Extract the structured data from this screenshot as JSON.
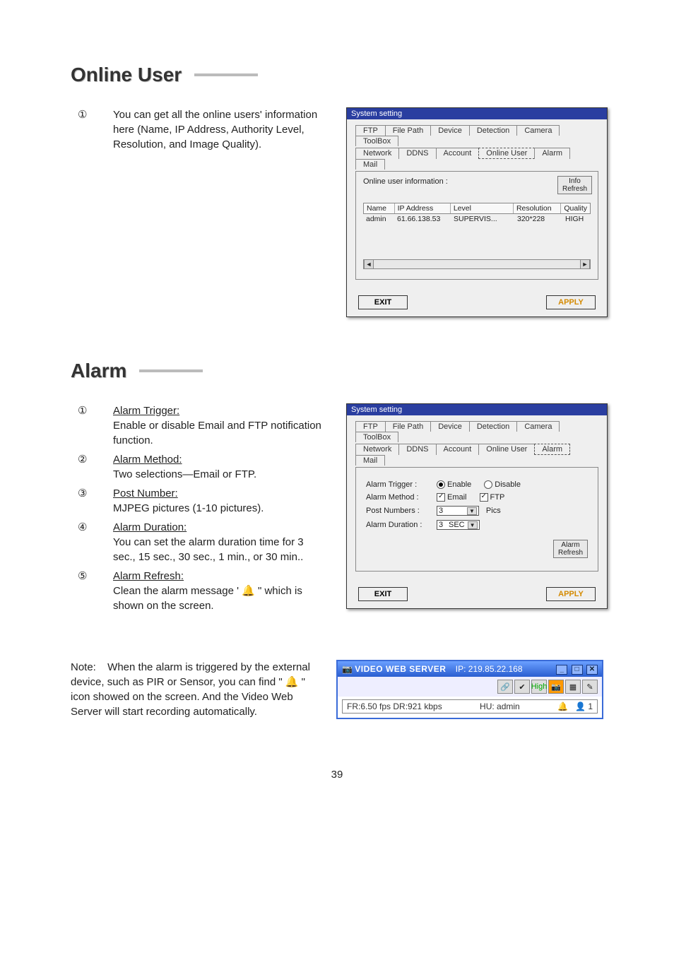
{
  "page_number": "39",
  "section_online_user": {
    "title": "Online User",
    "bullet_glyph": "①",
    "bullet_text": "You can get all the online users' information here (Name, IP Address, Authority Level, Resolution, and Image Quality).",
    "dialog": {
      "title": "System setting",
      "tabs_row1": [
        "FTP",
        "File Path",
        "Device",
        "Detection",
        "Camera",
        "ToolBox"
      ],
      "tabs_row2": [
        "Network",
        "DDNS",
        "Account",
        "Online User",
        "Alarm",
        "Mail"
      ],
      "active_tab": "Online User",
      "panel_label": "Online user information :",
      "info_btn_line1": "Info",
      "info_btn_line2": "Refresh",
      "columns": [
        "Name",
        "IP Address",
        "Level",
        "Resolution",
        "Quality"
      ],
      "row": {
        "name": "admin",
        "ip": "61.66.138.53",
        "level": "SUPERVIS...",
        "res": "320*228",
        "quality": "HIGH"
      },
      "exit": "EXIT",
      "apply": "APPLY"
    }
  },
  "section_alarm": {
    "title": "Alarm",
    "items": [
      {
        "glyph": "①",
        "head": "Alarm Trigger:",
        "body": "Enable or disable Email and FTP notification function."
      },
      {
        "glyph": "②",
        "head": "Alarm Method:",
        "body": "Two selections—Email or FTP."
      },
      {
        "glyph": "③",
        "head": "Post Number:",
        "body": "MJPEG  pictures (1-10 pictures)."
      },
      {
        "glyph": "④",
        "head": "Alarm Duration:",
        "body": "You can set the alarm duration time for 3 sec., 15 sec., 30 sec., 1 min., or 30 min.."
      },
      {
        "glyph": "⑤",
        "head": "Alarm Refresh:",
        "body_pre": "Clean the alarm message ' ",
        "body_post": " \" which is shown on the screen."
      }
    ],
    "dialog": {
      "title": "System setting",
      "tabs_row1": [
        "FTP",
        "File Path",
        "Device",
        "Detection",
        "Camera",
        "ToolBox"
      ],
      "tabs_row2": [
        "Network",
        "DDNS",
        "Account",
        "Online User",
        "Alarm",
        "Mail"
      ],
      "active_tab": "Alarm",
      "labels": {
        "trigger": "Alarm Trigger :",
        "enable": "Enable",
        "disable": "Disable",
        "method": "Alarm Method :",
        "email": "Email",
        "ftp": "FTP",
        "post": "Post Numbers :",
        "post_value": "3",
        "pics": "Pics",
        "duration": "Alarm Duration :",
        "dur_value": "3",
        "sec": "SEC",
        "refresh_line1": "Alarm",
        "refresh_line2": "Refresh"
      },
      "exit": "EXIT",
      "apply": "APPLY"
    }
  },
  "note": {
    "lead": "Note:",
    "text_pre": "When the alarm is triggered by the external device, such as PIR or Sensor, you can find \" ",
    "text_post": " \" icon showed on the screen. And the Video Web Server will start recording automatically."
  },
  "vws": {
    "app_name": "VIDEO WEB SERVER",
    "ip_label": "IP:  219.85.22.168",
    "toolbar_high": "High",
    "status_left": "FR:6.50 fps DR:921 kbps",
    "status_mid": "HU: admin",
    "status_count": "1"
  }
}
